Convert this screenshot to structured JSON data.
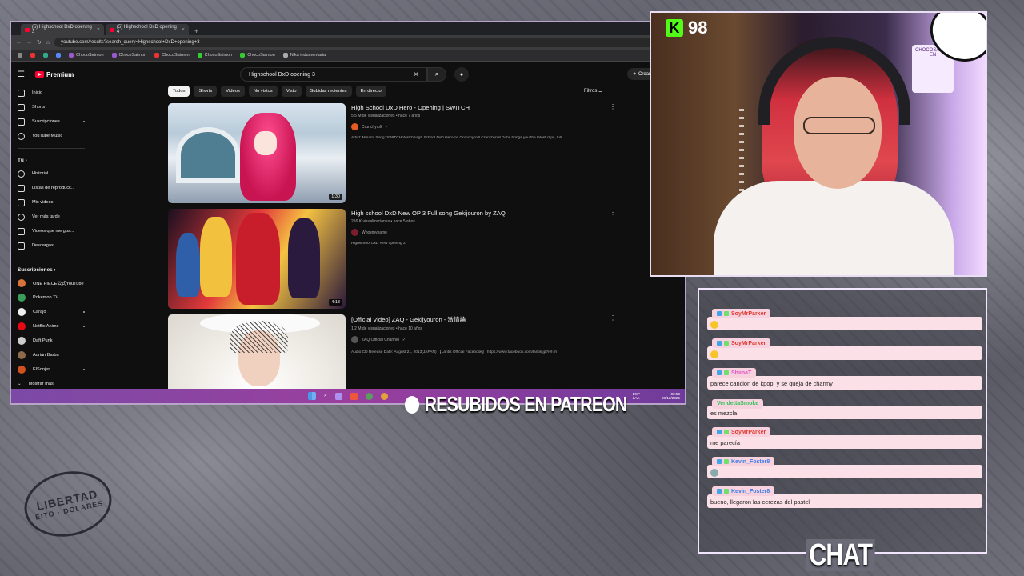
{
  "browser": {
    "tabs": [
      {
        "label": "(5) Highschool DxD opening 3"
      },
      {
        "label": "(5) Highschool DxD opening 4"
      }
    ],
    "url": "youtube.com/results?search_query=Highschool+DxD+opening+3",
    "bookmarks": [
      "ChocoSaimon",
      "ChocoSaimon",
      "ChocoSaimon",
      "ChocoSaimon",
      "ChocoSaimon",
      "Nika indumentaria"
    ]
  },
  "youtube": {
    "logo": "Premium",
    "search_query": "Highschool DxD opening 3",
    "create_label": "Crear",
    "chips": [
      "Todos",
      "Shorts",
      "Videos",
      "No vistos",
      "Visto",
      "Subidas recientes",
      "En directo"
    ],
    "filters_label": "Filtros",
    "sidebar": {
      "main": [
        {
          "label": "Inicio",
          "icon": "home-icon"
        },
        {
          "label": "Shorts",
          "icon": "shorts-icon"
        },
        {
          "label": "Suscripciones",
          "icon": "subscriptions-icon"
        },
        {
          "label": "YouTube Music",
          "icon": "music-icon"
        }
      ],
      "you_heading": "Tú",
      "you": [
        {
          "label": "Historial",
          "icon": "history-icon"
        },
        {
          "label": "Listas de reproducc...",
          "icon": "playlist-icon"
        },
        {
          "label": "Mis videos",
          "icon": "video-icon"
        },
        {
          "label": "Ver más tarde",
          "icon": "clock-icon"
        },
        {
          "label": "Videos que me gus...",
          "icon": "like-icon"
        },
        {
          "label": "Descargas",
          "icon": "download-icon"
        }
      ],
      "subs_heading": "Suscripciones",
      "subs": [
        {
          "label": "ONE PIECE公式YouTube",
          "color": "#d8743a"
        },
        {
          "label": "Pokémon TV",
          "color": "#3a9e5a"
        },
        {
          "label": "Carajo",
          "color": "#eeeeee"
        },
        {
          "label": "Netflix Anime",
          "color": "#e50914"
        },
        {
          "label": "Daft Punk",
          "color": "#cccccc"
        },
        {
          "label": "Adrián Barba",
          "color": "#8c6a4a"
        },
        {
          "label": "ElSonjer",
          "color": "#d0501e"
        }
      ],
      "more": "Mostrar más"
    },
    "results": [
      {
        "title": "High School DxD Hero - Opening | SWITCH",
        "meta": "5,5 M de visualizaciones • hace 7 años",
        "channel": "Crunchyroll",
        "description": "Artist: Minami Song: SWITCH Watch High School DxD Hero on Crunchyroll! Crunchyroll Dubs brings you the latest clips, full ...",
        "duration": "1:30"
      },
      {
        "title": "High school DxD New OP 3 Full song Gekijouron by ZAQ",
        "meta": "216 K visualizaciones • hace 5 años",
        "channel": "Whosmyname",
        "description": "Highschool DxD New opening 2.",
        "duration": "4:18"
      },
      {
        "title": "[Official Video] ZAQ - Gekijyouron - 激情論",
        "meta": "1,2 M de visualizaciones • hace 10 años",
        "channel": "ZAQ Official Channel",
        "description": "Audio CD Release Date: August 21, 2013(JAPAN) 【Lantis Official Facebook】 https://www.facebook.com/lantis.jp?ref=h",
        "duration": ""
      }
    ]
  },
  "taskbar": {
    "lang1": "ESP",
    "lang2": "LAA",
    "time": "03:56",
    "date": "28/12/2025"
  },
  "overlay": {
    "patreon_text": "RESUBIDOS EN PATREON",
    "kick_count": "98",
    "chat_title": "CHAT",
    "wall_sign": "CHOCOSAIMON EN"
  },
  "chat": [
    {
      "user": "SoyMrParker",
      "user_color": "#e0392e",
      "text": ""
    },
    {
      "user": "SoyMrParker",
      "user_color": "#e0392e",
      "text": ""
    },
    {
      "user": "ShiinaT",
      "user_color": "#e054c8",
      "text": "parece canción de kpop, y se queja de charmy"
    },
    {
      "user": "VendettaSmoke",
      "user_color": "#2ec45a",
      "text": "es mezcla"
    },
    {
      "user": "SoyMrParker",
      "user_color": "#e0392e",
      "text": "me parecía"
    },
    {
      "user": "Kevin_Foster8",
      "user_color": "#3b7de8",
      "text": ""
    },
    {
      "user": "Kevin_Foster8",
      "user_color": "#3b7de8",
      "text": "bueno, llegaron las cerezas del pastel"
    }
  ]
}
